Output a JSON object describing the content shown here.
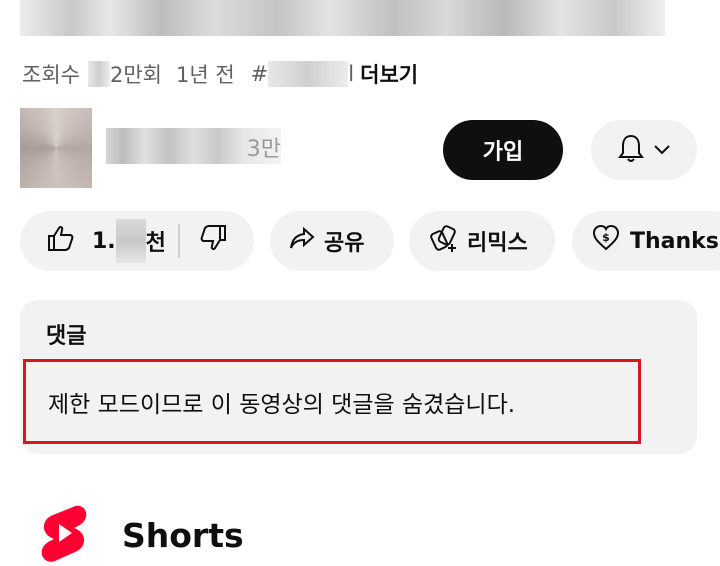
{
  "video": {
    "meta_views_prefix": "조회수",
    "meta_views_suffix": "2만회",
    "meta_age": "1년 전",
    "meta_hashtag_prefix": "#",
    "meta_hashtag_suffix": "l",
    "more_label": "더보기"
  },
  "channel": {
    "name_suffix": "3만",
    "join_label": "가입"
  },
  "actions": {
    "like_count_prefix": "1.",
    "like_count_suffix": "천",
    "share_label": "공유",
    "remix_label": "리믹스",
    "thanks_label": "Thanks"
  },
  "comments": {
    "title": "댓글",
    "notice": "제한 모드이므로 이 동영상의 댓글을 숨겼습니다."
  },
  "shorts": {
    "label": "Shorts"
  },
  "colors": {
    "accent_red": "#d7191f",
    "shorts_red": "#ff0033",
    "pill_bg": "#f2f2f2",
    "text": "#0f0f0f"
  },
  "icons": [
    "like-icon",
    "dislike-icon",
    "share-icon",
    "remix-icon",
    "thanks-icon",
    "bell-icon",
    "chevron-down-icon",
    "shorts-logo-icon"
  ]
}
